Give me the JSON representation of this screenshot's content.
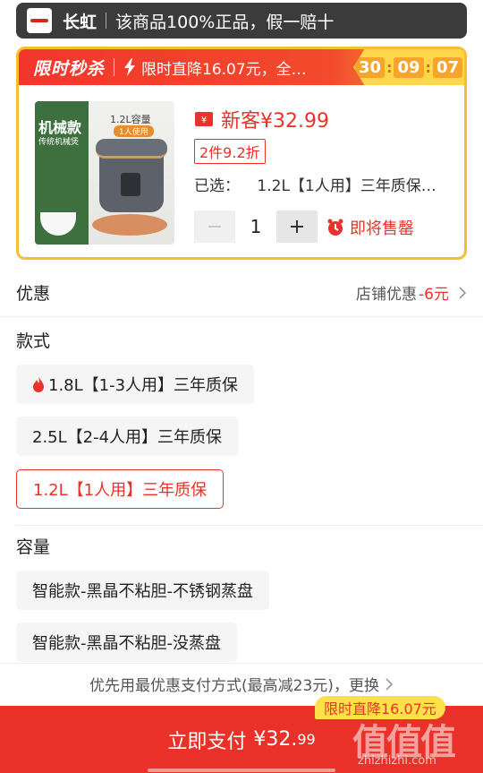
{
  "store": {
    "name": "长虹",
    "slogan": "该商品100%正品，假一赔十"
  },
  "flash_sale": {
    "title": "限时秒杀",
    "description": "限时直降16.07元，全…",
    "countdown": {
      "h": "30",
      "m": "09",
      "s": "07"
    }
  },
  "product": {
    "thumb": {
      "tag": "机械款",
      "subtag": "传统机械煲",
      "capacity": "1.2L容量",
      "users": "1人使用"
    },
    "price_label": "新客¥32.99",
    "promo": "2件9.2折",
    "selected_label": "已选：",
    "selected_value": "1.2L【1人用】三年质保…",
    "quantity": "1",
    "stock_status": "即将售罄"
  },
  "discount": {
    "title": "优惠",
    "label": "店铺优惠",
    "amount": "-6元"
  },
  "style_section": {
    "title": "款式",
    "options": [
      {
        "label": "1.8L【1-3人用】三年质保",
        "hot": true
      },
      {
        "label": "2.5L【2-4人用】三年质保",
        "hot": false
      },
      {
        "label": "1.2L【1人用】三年质保",
        "selected": true
      }
    ]
  },
  "capacity_section": {
    "title": "容量",
    "options": [
      {
        "label": "智能款-黑晶不粘胆-不锈钢蒸盘"
      },
      {
        "label": "智能款-黑晶不粘胆-没蒸盘"
      }
    ]
  },
  "payment": {
    "tip": "优先用最优惠支付方式(最高减23元)，更换",
    "button_label": "立即支付",
    "button_price": "¥32.",
    "button_cents": "99",
    "badge": "限时直降16.07元"
  },
  "watermark": {
    "logo": "值值值",
    "site": "zhizhizhi.com"
  },
  "colors": {
    "accent": "#e9322b",
    "flash_yellow": "#f7be2f",
    "header": "#3b3b3b"
  }
}
